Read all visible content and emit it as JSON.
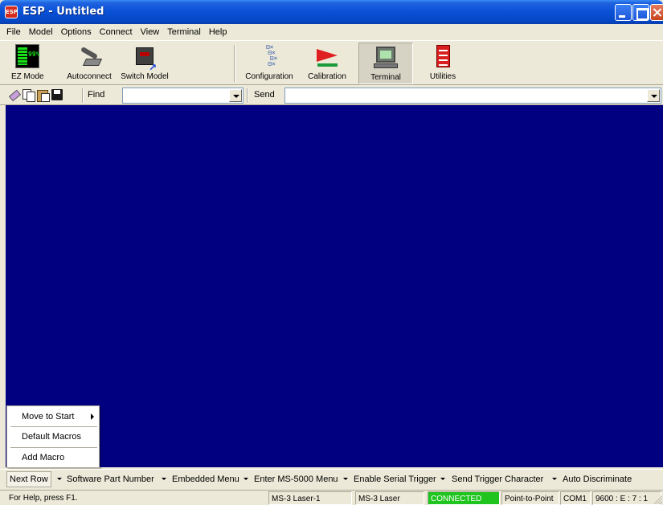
{
  "window": {
    "icon_text": "ESP",
    "title": "ESP - Untitled"
  },
  "menu": [
    "File",
    "Model",
    "Options",
    "Connect",
    "View",
    "Terminal",
    "Help"
  ],
  "toolbar": {
    "ez_mode": {
      "label": "EZ Mode",
      "icon_text": "99%"
    },
    "autoconnect": {
      "label": "Autoconnect"
    },
    "switch_model": {
      "label": "Switch Model"
    },
    "configuration": {
      "label": "Configuration"
    },
    "calibration": {
      "label": "Calibration"
    },
    "terminal": {
      "label": "Terminal",
      "pressed": true
    },
    "utilities": {
      "label": "Utilities"
    }
  },
  "findbar": {
    "find_label": "Find",
    "find_value": "",
    "send_label": "Send",
    "send_value": ""
  },
  "terminal": {
    "background": "#000080"
  },
  "popup_menu": {
    "items": [
      "Move to Start",
      "Default Macros",
      "Add Macro"
    ]
  },
  "macro_bar": {
    "items": [
      "Next Row",
      "Software Part Number",
      "Embedded Menu",
      "Enter MS-5000 Menu",
      "Enable Serial Trigger",
      "Send Trigger Character",
      "Auto Discriminate"
    ]
  },
  "status_bar": {
    "help": "For Help, press F1.",
    "model1": "MS-3 Laser-1",
    "model2": "MS-3 Laser",
    "connection": "CONNECTED",
    "connection_color": "#1fc41f",
    "mode": "Point-to-Point",
    "port": "COM1",
    "settings": "9600 : E : 7 : 1"
  }
}
